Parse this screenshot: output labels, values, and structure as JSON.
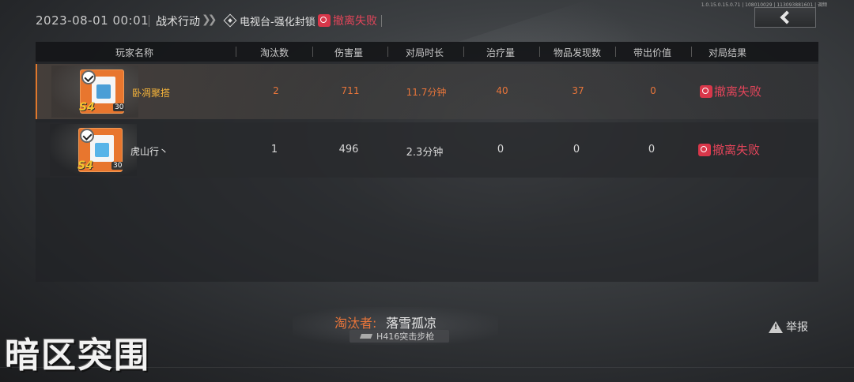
{
  "header": {
    "datetime": "2023-08-01 00:01",
    "mode": "战术行动",
    "chevrons": "❯❯",
    "map": "电视台-强化封锁",
    "result": "撤离失败",
    "version": "1.0.15.0.15.0.71 | 108010029 | 113093881601 | 调频"
  },
  "columns": [
    "玩家名称",
    "淘汰数",
    "伤害量",
    "对局时长",
    "治疗量",
    "物品发现数",
    "带出价值",
    "对局结果"
  ],
  "players": [
    {
      "name": "卧凋聚搭",
      "season": "S4",
      "level": "30",
      "eliminations": "2",
      "damage": "711",
      "duration": "11.7分钟",
      "healing": "40",
      "items_found": "37",
      "extract_value": "0",
      "result": "撤离失败"
    },
    {
      "name": "虎山行丶",
      "season": "S4",
      "level": "30",
      "eliminations": "1",
      "damage": "496",
      "duration": "2.3分钟",
      "healing": "0",
      "items_found": "0",
      "extract_value": "0",
      "result": "撤离失败"
    }
  ],
  "killer": {
    "label": "淘汰者:",
    "name": "落雪孤凉",
    "weapon": "H416突击步枪"
  },
  "report_label": "举报",
  "logo_text": "暗区突围",
  "colors": {
    "accent_orange": "#e8753a",
    "fail_red": "#e2455a",
    "gold": "#f3b23a"
  },
  "icons": {
    "back": "back-arrow-icon",
    "fail": "fail-icon",
    "report": "warning-icon",
    "weapon": "gun-icon"
  }
}
